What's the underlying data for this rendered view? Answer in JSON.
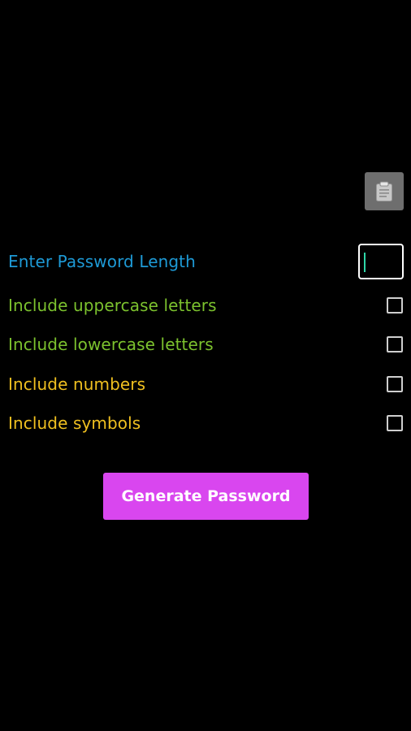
{
  "toolbar": {
    "copy_icon": "clipboard-icon",
    "copy_button_color": "#6e6e6e"
  },
  "password_length": {
    "label": "Enter Password Length",
    "label_color": "#1e9ad6",
    "value": ""
  },
  "options": [
    {
      "label": "Include uppercase letters",
      "color": "#7cc22e",
      "checked": false
    },
    {
      "label": "Include lowercase letters",
      "color": "#7cc22e",
      "checked": false
    },
    {
      "label": "Include numbers",
      "color": "#f0c020",
      "checked": false
    },
    {
      "label": "Include symbols",
      "color": "#f0c020",
      "checked": false
    }
  ],
  "generate_button": {
    "label": "Generate Password",
    "color": "#d946ef"
  }
}
